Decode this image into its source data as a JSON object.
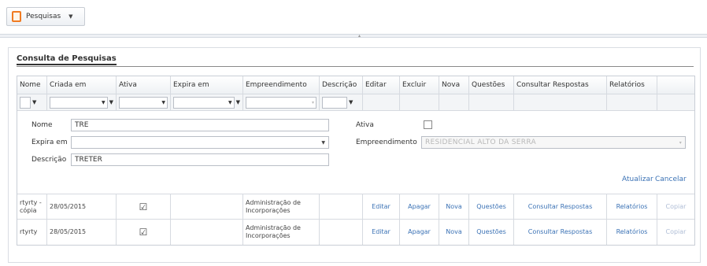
{
  "toolbar": {
    "menu_label": "Pesquisas",
    "menu_icon": "document-icon",
    "caret": "▼"
  },
  "panel": {
    "title": "Consulta de Pesquisas"
  },
  "grid": {
    "columns": [
      "Nome",
      "Criada em",
      "Ativa",
      "Expira em",
      "Empreendimento",
      "Descrição",
      "Editar",
      "Excluir",
      "Nova",
      "Questões",
      "Consultar Respostas",
      "Relatórios"
    ],
    "filter_glyph": "▼",
    "funnel_glyph": "▼"
  },
  "edit_form": {
    "nome_label": "Nome",
    "nome_value": "TRE",
    "expira_label": "Expira em",
    "expira_value": "",
    "descricao_label": "Descrição",
    "descricao_value": "TRETER",
    "ativa_label": "Ativa",
    "ativa_checked": false,
    "empreendimento_label": "Empreendimento",
    "empreendimento_value": "RESIDENCIAL ALTO DA SERRA",
    "update_link": "Atualizar",
    "cancel_link": "Cancelar"
  },
  "rows": [
    {
      "nome": "rtyrty - cópia",
      "criada": "28/05/2015",
      "ativa": "☑",
      "expira": "",
      "empreendimento": "Administração de Incorporações",
      "descricao": "",
      "editar": "Editar",
      "excluir": "Apagar",
      "nova": "Nova",
      "questoes": "Questões",
      "consultar": "Consultar Respostas",
      "relatorios": "Relatórios",
      "copiar": "Copiar"
    },
    {
      "nome": "rtyrty",
      "criada": "28/05/2015",
      "ativa": "☑",
      "expira": "",
      "empreendimento": "Administração de Incorporações",
      "descricao": "",
      "editar": "Editar",
      "excluir": "Apagar",
      "nova": "Nova",
      "questoes": "Questões",
      "consultar": "Consultar Respostas",
      "relatorios": "Relatórios",
      "copiar": "Copiar"
    }
  ],
  "colors": {
    "link": "#3b72b5",
    "disabled_link": "#b0bed6",
    "accent_icon": "#f07b22"
  }
}
